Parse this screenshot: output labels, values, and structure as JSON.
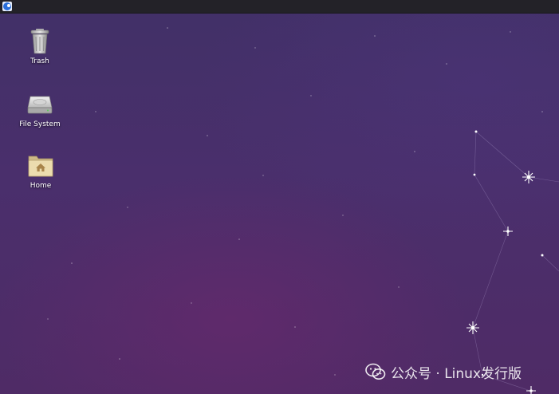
{
  "desktop": {
    "icons": [
      {
        "label": "Trash",
        "icon": "trash-icon"
      },
      {
        "label": "File System",
        "icon": "drive-icon"
      },
      {
        "label": "Home",
        "icon": "home-folder-icon"
      }
    ]
  },
  "panel": {
    "menu_icon": "whisker-menu-icon"
  },
  "watermark": {
    "text": "公众号 · Linux发行版",
    "logo": "wechat-logo"
  },
  "colors": {
    "panel": "#232228",
    "wallpaper_top": "#413067",
    "wallpaper_bottom": "#4f2b66",
    "folder": "#e9d8a6"
  }
}
